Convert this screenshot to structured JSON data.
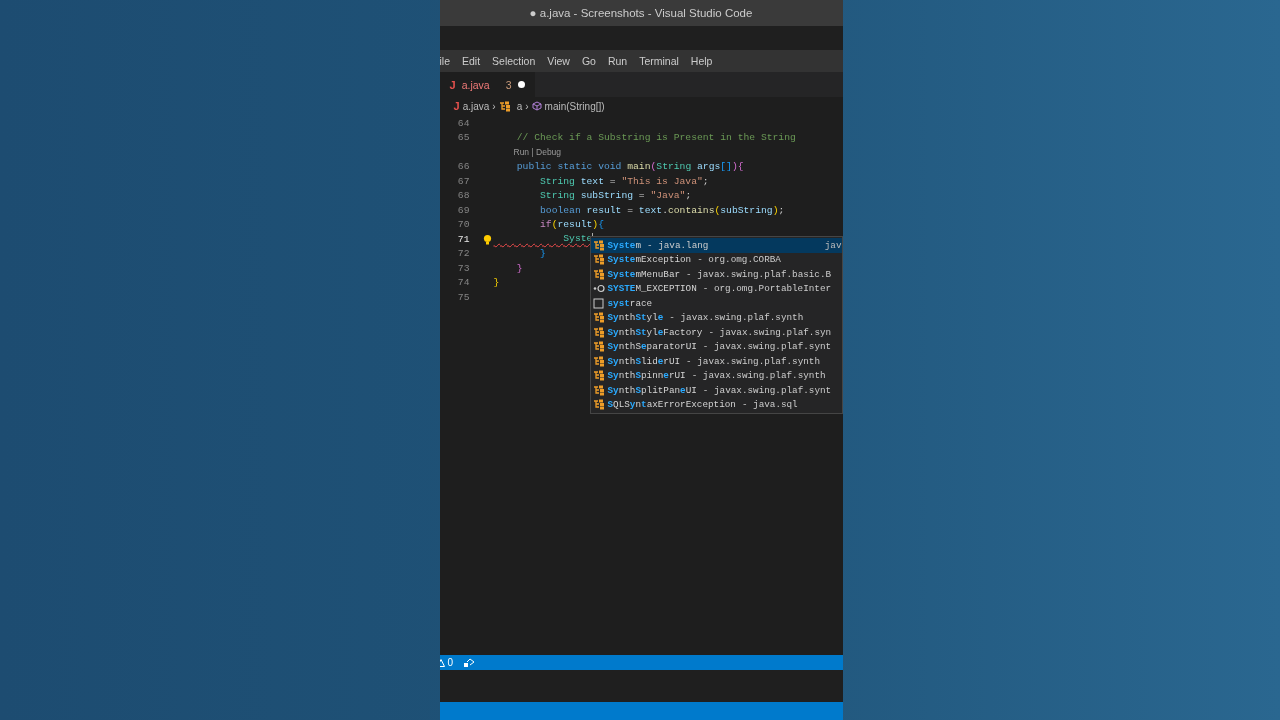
{
  "window": {
    "title": "● a.java - Screenshots - Visual Studio Code"
  },
  "menu": [
    "ile",
    "Edit",
    "Selection",
    "View",
    "Go",
    "Run",
    "Terminal",
    "Help"
  ],
  "tab": {
    "icon": "J",
    "label": "a.java",
    "problems": "3",
    "modified": true,
    "selected": true
  },
  "breadcrumb": {
    "icon": "J",
    "file": "a.java",
    "sep": "›",
    "class": "a",
    "method": "main(String[])"
  },
  "lines": [
    {
      "number": "64",
      "active": false,
      "lightbulb": false
    },
    {
      "number": "65",
      "active": false,
      "lightbulb": false,
      "tokens": [
        {
          "text": "    // Check if a Substring is Present in the String",
          "kind": "comment"
        }
      ]
    },
    {
      "number": "66",
      "active": false,
      "lightbulb": false,
      "codelens": "Run | Debug",
      "tokens": [
        {
          "text": "    public static void",
          "kind": "kw"
        },
        {
          "text": " main",
          "kind": "fn"
        },
        {
          "text": "(",
          "kind": "b2"
        },
        {
          "text": "String",
          "kind": "type"
        },
        {
          "text": " args",
          "kind": "var"
        },
        {
          "text": "[]",
          "kind": "b3"
        },
        {
          "text": ")",
          "kind": "b2"
        },
        {
          "text": "{",
          "kind": "b2"
        }
      ]
    },
    {
      "number": "67",
      "active": false,
      "lightbulb": false,
      "tokens": [
        {
          "text": "        String",
          "kind": "type"
        },
        {
          "text": " text",
          "kind": "var"
        },
        {
          "text": " = ",
          "kind": "plain"
        },
        {
          "text": "\"This is Java\"",
          "kind": "str"
        },
        {
          "text": ";",
          "kind": "plain"
        }
      ]
    },
    {
      "number": "68",
      "active": false,
      "lightbulb": false,
      "tokens": [
        {
          "text": "        String",
          "kind": "type"
        },
        {
          "text": " subString",
          "kind": "var"
        },
        {
          "text": " = ",
          "kind": "plain"
        },
        {
          "text": "\"Java\"",
          "kind": "str"
        },
        {
          "text": ";",
          "kind": "plain"
        }
      ]
    },
    {
      "number": "69",
      "active": false,
      "lightbulb": false,
      "tokens": [
        {
          "text": "        boolean",
          "kind": "kw"
        },
        {
          "text": " result",
          "kind": "var"
        },
        {
          "text": " = ",
          "kind": "plain"
        },
        {
          "text": "text",
          "kind": "var"
        },
        {
          "text": ".",
          "kind": "plain"
        },
        {
          "text": "contains",
          "kind": "fn"
        },
        {
          "text": "(",
          "kind": "b1"
        },
        {
          "text": "subString",
          "kind": "var"
        },
        {
          "text": ")",
          "kind": "b1"
        },
        {
          "text": ";",
          "kind": "plain"
        }
      ]
    },
    {
      "number": "70",
      "active": false,
      "lightbulb": false,
      "tokens": [
        {
          "text": "        if",
          "kind": "ctrl"
        },
        {
          "text": "(",
          "kind": "b1"
        },
        {
          "text": "result",
          "kind": "var"
        },
        {
          "text": ")",
          "kind": "b1"
        },
        {
          "text": "{",
          "kind": "b3"
        }
      ]
    },
    {
      "number": "71",
      "active": true,
      "lightbulb": true,
      "tokens": [
        {
          "text": "            Syste",
          "kind": "error"
        }
      ]
    },
    {
      "number": "72",
      "active": false,
      "lightbulb": false,
      "tokens": [
        {
          "text": "        }",
          "kind": "b3"
        }
      ]
    },
    {
      "number": "73",
      "active": false,
      "lightbulb": false,
      "tokens": [
        {
          "text": "    }",
          "kind": "b2"
        }
      ]
    },
    {
      "number": "74",
      "active": false,
      "lightbulb": false,
      "tokens": [
        {
          "text": "}",
          "kind": "b1"
        }
      ]
    },
    {
      "number": "75",
      "active": false,
      "lightbulb": false
    }
  ],
  "suggestions": [
    {
      "kind": "class",
      "selected": true,
      "parts": [
        {
          "text": "Syste",
          "match": true
        },
        {
          "text": "m",
          "match": false
        }
      ],
      "detail": "- java.lang",
      "hint": "jav"
    },
    {
      "kind": "class",
      "selected": false,
      "parts": [
        {
          "text": "Syste",
          "match": true
        },
        {
          "text": "mException",
          "match": false
        }
      ],
      "detail": "- org.omg.CORBA"
    },
    {
      "kind": "class",
      "selected": false,
      "parts": [
        {
          "text": "Syste",
          "match": true
        },
        {
          "text": "mMenuBar",
          "match": false
        }
      ],
      "detail": "- javax.swing.plaf.basic.B"
    },
    {
      "kind": "constant",
      "selected": false,
      "parts": [
        {
          "text": "SYSTE",
          "match": true
        },
        {
          "text": "M_EXCEPTION",
          "match": false
        }
      ],
      "detail": "- org.omg.PortableInter"
    },
    {
      "kind": "snippet",
      "selected": false,
      "parts": [
        {
          "text": "syst",
          "match": true
        },
        {
          "text": "race",
          "match": false
        }
      ]
    },
    {
      "kind": "class",
      "selected": false,
      "parts": [
        {
          "text": "Sy",
          "match": true
        },
        {
          "text": "nth",
          "match": false
        },
        {
          "text": "St",
          "match": true
        },
        {
          "text": "yl",
          "match": false
        },
        {
          "text": "e",
          "match": true
        }
      ],
      "detail": "- javax.swing.plaf.synth"
    },
    {
      "kind": "class",
      "selected": false,
      "parts": [
        {
          "text": "Sy",
          "match": true
        },
        {
          "text": "nth",
          "match": false
        },
        {
          "text": "St",
          "match": true
        },
        {
          "text": "yl",
          "match": false
        },
        {
          "text": "e",
          "match": true
        },
        {
          "text": "Factory",
          "match": false
        }
      ],
      "detail": "- javax.swing.plaf.syn"
    },
    {
      "kind": "class",
      "selected": false,
      "parts": [
        {
          "text": "Sy",
          "match": true
        },
        {
          "text": "nthS",
          "match": false
        },
        {
          "text": "e",
          "match": true
        },
        {
          "text": "paratorUI",
          "match": false
        }
      ],
      "detail": "- javax.swing.plaf.synt"
    },
    {
      "kind": "class",
      "selected": false,
      "parts": [
        {
          "text": "Sy",
          "match": true
        },
        {
          "text": "nth",
          "match": false
        },
        {
          "text": "S",
          "match": true
        },
        {
          "text": "lid",
          "match": false
        },
        {
          "text": "e",
          "match": true
        },
        {
          "text": "rUI",
          "match": false
        }
      ],
      "detail": "- javax.swing.plaf.synth"
    },
    {
      "kind": "class",
      "selected": false,
      "parts": [
        {
          "text": "Sy",
          "match": true
        },
        {
          "text": "nth",
          "match": false
        },
        {
          "text": "S",
          "match": true
        },
        {
          "text": "pinn",
          "match": false
        },
        {
          "text": "e",
          "match": true
        },
        {
          "text": "rUI",
          "match": false
        }
      ],
      "detail": "- javax.swing.plaf.synth"
    },
    {
      "kind": "class",
      "selected": false,
      "parts": [
        {
          "text": "Sy",
          "match": true
        },
        {
          "text": "nth",
          "match": false
        },
        {
          "text": "S",
          "match": true
        },
        {
          "text": "plitPan",
          "match": false
        },
        {
          "text": "e",
          "match": true
        },
        {
          "text": "UI",
          "match": false
        }
      ],
      "detail": "- javax.swing.plaf.synt"
    },
    {
      "kind": "class",
      "selected": false,
      "parts": [
        {
          "text": "S",
          "match": true
        },
        {
          "text": "QLS",
          "match": false
        },
        {
          "text": "y",
          "match": true
        },
        {
          "text": "n",
          "match": false
        },
        {
          "text": "t",
          "match": true
        },
        {
          "text": "axE",
          "match": false
        },
        {
          "text": "rrorException",
          "match": false
        }
      ],
      "detail": "- java.sql"
    }
  ],
  "status_bar": {
    "warnings": "0"
  }
}
